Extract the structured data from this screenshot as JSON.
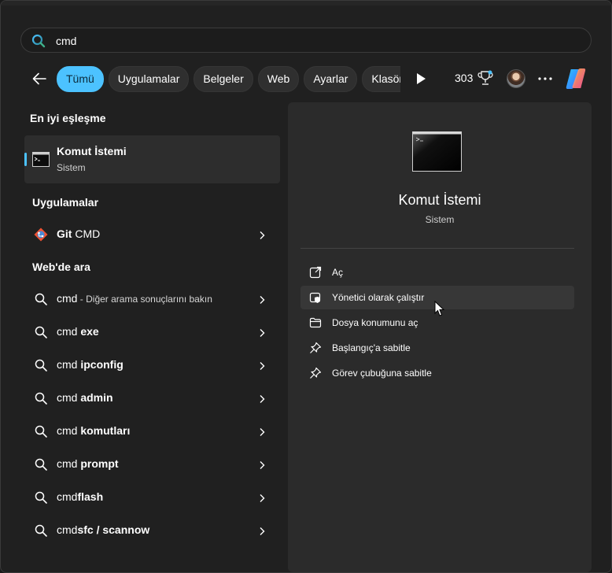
{
  "search": {
    "value": "cmd"
  },
  "filters": [
    {
      "label": "Tümü",
      "active": true
    },
    {
      "label": "Uygulamalar",
      "active": false
    },
    {
      "label": "Belgeler",
      "active": false
    },
    {
      "label": "Web",
      "active": false
    },
    {
      "label": "Ayarlar",
      "active": false
    },
    {
      "label": "Klasörle",
      "active": false
    }
  ],
  "rewards": {
    "points": "303"
  },
  "icons": {
    "search": "search-icon",
    "back": "back-arrow-icon",
    "play": "play-icon",
    "trophy": "trophy-icon",
    "more": "more-icon",
    "copilot": "copilot-icon",
    "cmd": "command-prompt-icon",
    "git": "git-icon",
    "chevron": "chevron-right-icon"
  },
  "colors": {
    "accent": "#4cc2ff",
    "background": "#202020",
    "panel": "#2b2b2b"
  },
  "best_match": {
    "heading": "En iyi eşleşme",
    "title": "Komut İstemi",
    "subtitle": "Sistem"
  },
  "apps": {
    "heading": "Uygulamalar",
    "items": [
      {
        "bold": "Git",
        "rest": " CMD"
      }
    ]
  },
  "web": {
    "heading": "Web'de ara",
    "items": [
      {
        "q": "cmd",
        "bold": "",
        "hint": " - Diğer arama sonuçlarını bakın"
      },
      {
        "q": "cmd ",
        "bold": "exe",
        "hint": ""
      },
      {
        "q": "cmd ",
        "bold": "ipconfig",
        "hint": ""
      },
      {
        "q": "cmd ",
        "bold": "admin",
        "hint": ""
      },
      {
        "q": "cmd ",
        "bold": "komutları",
        "hint": ""
      },
      {
        "q": "cmd ",
        "bold": "prompt",
        "hint": ""
      },
      {
        "q": "cmd",
        "bold": "flash",
        "hint": ""
      },
      {
        "q": "cmd",
        "bold": "sfc / scannow",
        "hint": ""
      }
    ]
  },
  "detail": {
    "title": "Komut İstemi",
    "subtitle": "Sistem",
    "actions": [
      {
        "label": "Aç",
        "icon": "open-external-icon"
      },
      {
        "label": "Yönetici olarak çalıştır",
        "icon": "shield-admin-icon",
        "hover": true
      },
      {
        "label": "Dosya konumunu aç",
        "icon": "folder-icon"
      },
      {
        "label": "Başlangıç'a sabitle",
        "icon": "pin-icon"
      },
      {
        "label": "Görev çubuğuna sabitle",
        "icon": "pin-icon"
      }
    ]
  }
}
